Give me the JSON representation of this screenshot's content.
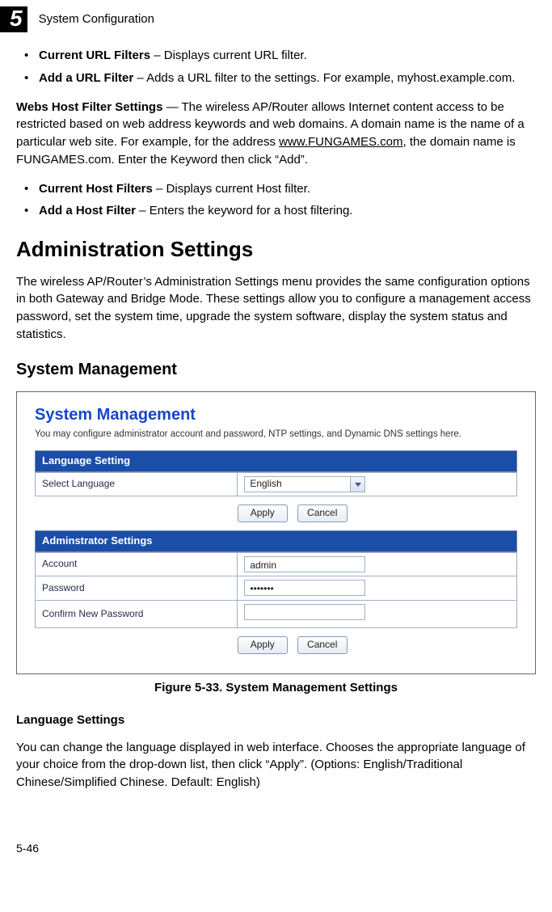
{
  "header": {
    "chapter_number": "5",
    "chapter_title": "System Configuration"
  },
  "url_filters": {
    "items": [
      {
        "bold": "Current URL Filters",
        "rest": " – Displays current URL filter."
      },
      {
        "bold": "Add a URL Filter",
        "rest": " – Adds a URL filter to the settings. For example, myhost.example.com."
      }
    ]
  },
  "webs_host": {
    "lead": "Webs Host Filter Settings",
    "sep": " — ",
    "text": "The wireless AP/Router allows Internet content access to be restricted based on web address keywords and web domains. A domain name is the name of a particular web site. For example, for the address ",
    "link": "www.FUNGAMES.com",
    "text2": ", the domain name is FUNGAMES.com. Enter the Keyword then click “Add”."
  },
  "host_filters": {
    "items": [
      {
        "bold": "Current Host Filters",
        "rest": " – Displays current Host filter."
      },
      {
        "bold": "Add a Host Filter",
        "rest": " – Enters the keyword for a host filtering."
      }
    ]
  },
  "admin_section": {
    "title": "Administration Settings",
    "intro": "The wireless AP/Router’s Administration Settings menu provides the same configuration options in both Gateway and Bridge Mode. These settings allow you to configure a management access password, set the system time, upgrade the system software, display the system status and statistics."
  },
  "sys_mgmt": {
    "title": "System Management"
  },
  "figure": {
    "title": "System Management",
    "subtitle": "You may configure administrator account and password, NTP settings, and Dynamic DNS settings here.",
    "lang_panel": {
      "header": "Language Setting",
      "row_label": "Select Language",
      "select_value": "English"
    },
    "admin_panel": {
      "header": "Adminstrator Settings",
      "account_label": "Account",
      "account_value": "admin",
      "password_label": "Password",
      "password_value": "•••••••",
      "confirm_label": "Confirm New Password",
      "confirm_value": ""
    },
    "buttons": {
      "apply": "Apply",
      "cancel": "Cancel"
    },
    "caption": "Figure 5-33.   System Management Settings"
  },
  "lang_settings": {
    "heading": "Language Settings",
    "text": "You can change the language displayed in web interface. Chooses the appropriate language of your choice from the drop-down list, then click “Apply”. (Options: English/Traditional Chinese/Simplified Chinese. Default: English)"
  },
  "footer": {
    "page": "5-46"
  }
}
